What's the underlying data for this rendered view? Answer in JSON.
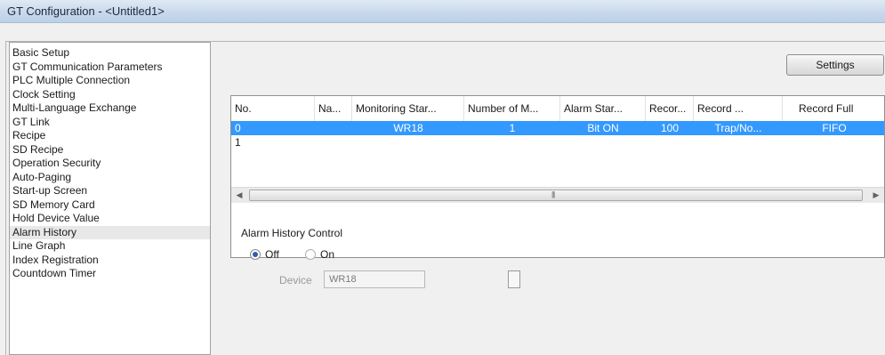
{
  "window": {
    "title": "GT Configuration - <Untitled1>"
  },
  "sidebar": {
    "items": [
      {
        "label": "Basic Setup"
      },
      {
        "label": "GT Communication Parameters"
      },
      {
        "label": "PLC Multiple Connection"
      },
      {
        "label": "Clock Setting"
      },
      {
        "label": "Multi-Language Exchange"
      },
      {
        "label": "GT Link"
      },
      {
        "label": "Recipe"
      },
      {
        "label": "SD Recipe"
      },
      {
        "label": "Operation Security"
      },
      {
        "label": "Auto-Paging"
      },
      {
        "label": "Start-up Screen"
      },
      {
        "label": "SD Memory Card"
      },
      {
        "label": "Hold Device Value"
      },
      {
        "label": "Alarm History"
      },
      {
        "label": "Line Graph"
      },
      {
        "label": "Index Registration"
      },
      {
        "label": "Countdown Timer"
      }
    ],
    "selected": "Alarm History"
  },
  "toolbar": {
    "settings_label": "Settings"
  },
  "alarm_table": {
    "columns": [
      "No.",
      "Na...",
      "Monitoring Star...",
      "Number of M...",
      "Alarm Star...",
      "Recor...",
      "Record ...",
      "Record Full"
    ],
    "rows": [
      [
        "0",
        "",
        "WR18",
        "1",
        "Bit ON",
        "100",
        "Trap/No...",
        "FIFO"
      ],
      [
        "1",
        "",
        "",
        "",
        "",
        "",
        "",
        ""
      ]
    ],
    "scroll_grip": "|||"
  },
  "history_control": {
    "title": "Alarm History Control",
    "off_label": "Off",
    "on_label": "On",
    "selected": "Off",
    "device_label": "Device",
    "device_value": "WR18"
  }
}
